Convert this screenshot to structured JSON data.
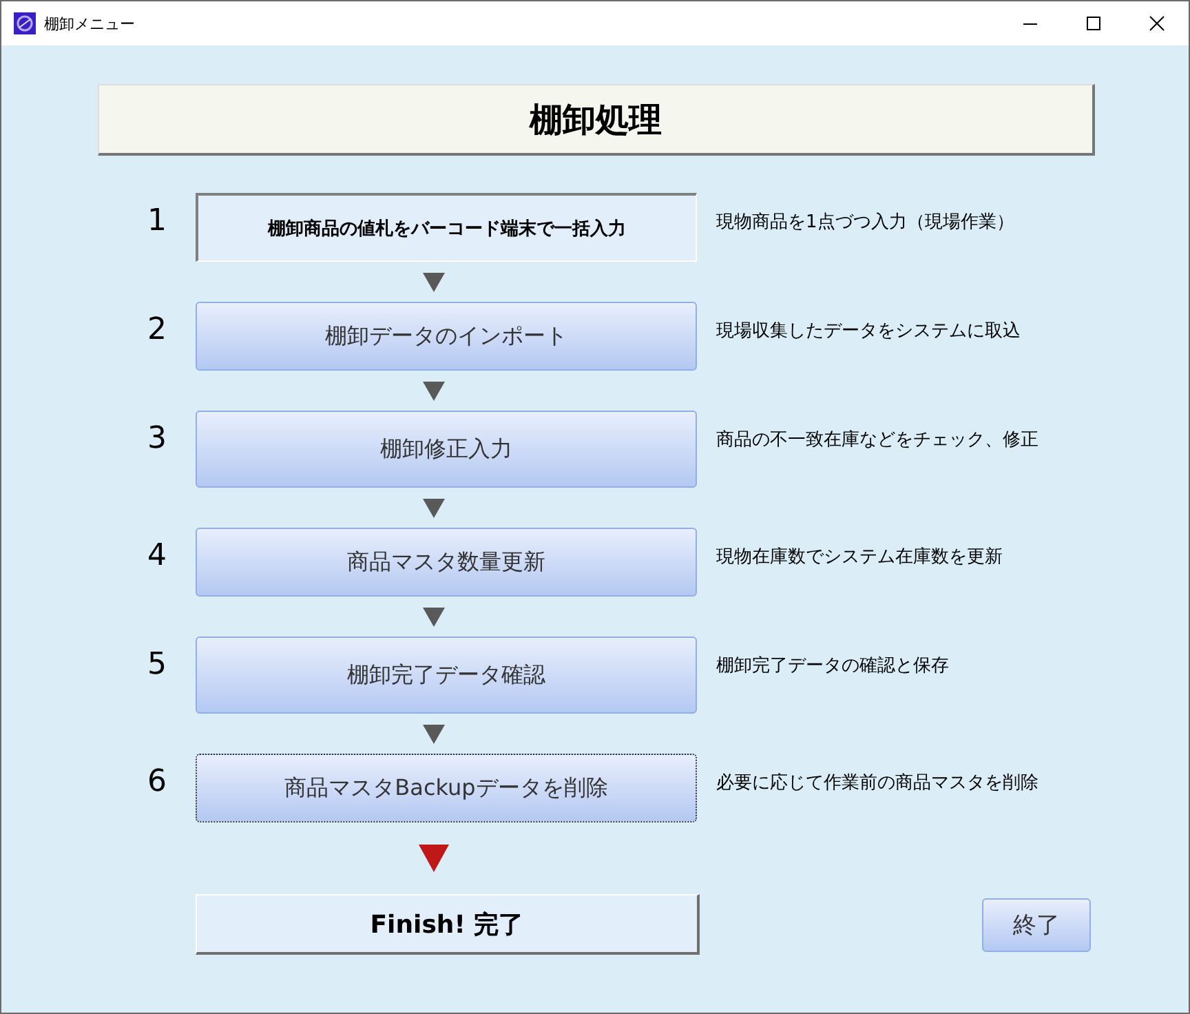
{
  "window": {
    "title": "棚卸メニュー"
  },
  "header": {
    "title": "棚卸処理"
  },
  "steps": [
    {
      "number": "1",
      "label": "棚卸商品の値札をバーコード端末で一括入力",
      "kind": "panel",
      "focused": false,
      "description": "現物商品を1点づつ入力（現場作業）"
    },
    {
      "number": "2",
      "label": "棚卸データのインポート",
      "kind": "button",
      "focused": false,
      "description": "現場収集したデータをシステムに取込"
    },
    {
      "number": "3",
      "label": "棚卸修正入力",
      "kind": "button",
      "focused": false,
      "description": "商品の不一致在庫などをチェック、修正"
    },
    {
      "number": "4",
      "label": "商品マスタ数量更新",
      "kind": "button",
      "focused": false,
      "description": "現物在庫数でシステム在庫数を更新"
    },
    {
      "number": "5",
      "label": "棚卸完了データ確認",
      "kind": "button",
      "focused": false,
      "description": "棚卸完了データの確認と保存"
    },
    {
      "number": "6",
      "label": "商品マスタBackupデータを削除",
      "kind": "button",
      "focused": true,
      "description": "必要に応じて作業前の商品マスタを削除"
    }
  ],
  "finish": {
    "label": "Finish! 完了"
  },
  "close_button": {
    "label": "終了"
  }
}
